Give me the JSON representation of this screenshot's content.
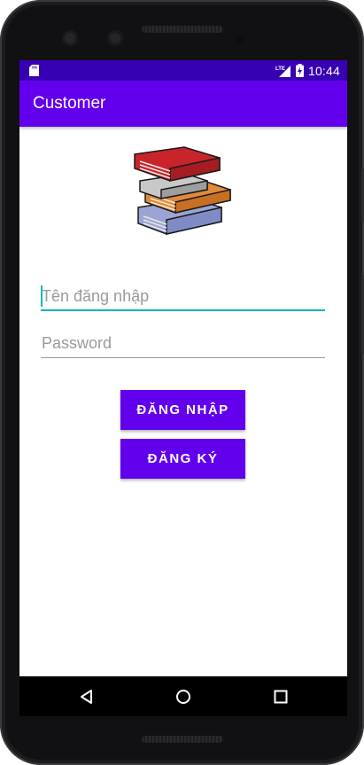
{
  "status_bar": {
    "time": "10:44",
    "network_label": "LTE",
    "icons": [
      "sd-card-icon",
      "lte-signal-icon",
      "battery-charging-icon"
    ]
  },
  "app_bar": {
    "title": "Customer"
  },
  "header_image": {
    "icon": "stack-of-books-icon"
  },
  "login_form": {
    "username_placeholder": "Tên đăng nhập",
    "username_value": "",
    "password_placeholder": "Password",
    "password_value": "",
    "login_button_label": "ĐĂNG NHẬP",
    "register_button_label": "ĐĂNG KÝ"
  },
  "navigation": {
    "icons": [
      "back-icon",
      "home-icon",
      "recent-apps-icon"
    ]
  },
  "colors": {
    "primary": "#6200ee",
    "primary_dark": "#3700b3",
    "accent": "#11b5b5"
  }
}
